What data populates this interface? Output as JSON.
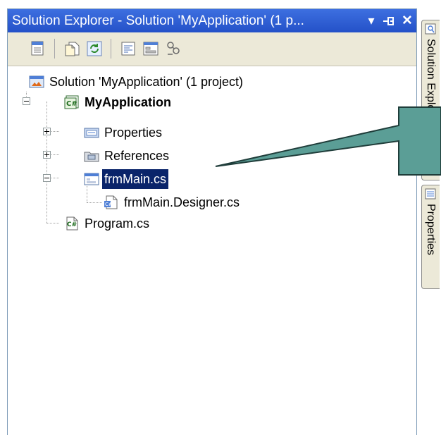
{
  "panel": {
    "title": "Solution Explorer - Solution 'MyApplication' (1 p...",
    "dropdown_glyph": "▾",
    "pin_glyph": "⊣",
    "close_glyph": "✕"
  },
  "toolbar": {
    "buttons": [
      "properties-icon",
      "show-all-files-icon",
      "refresh-icon",
      "view-code-icon",
      "view-designer-icon",
      "class-diagram-icon"
    ]
  },
  "tree": {
    "solution": "Solution 'MyApplication' (1 project)",
    "project": "MyApplication",
    "properties": "Properties",
    "references": "References",
    "frmMain": "frmMain.cs",
    "designer": "frmMain.Designer.cs",
    "program": "Program.cs"
  },
  "side_tabs": {
    "solution_explorer": "Solution Explorer",
    "properties": "Properties"
  },
  "colors": {
    "title_bar": "#2451c8",
    "selection": "#0a246a",
    "callout_fill": "#5b9e96",
    "callout_stroke": "#1f3d3a"
  }
}
